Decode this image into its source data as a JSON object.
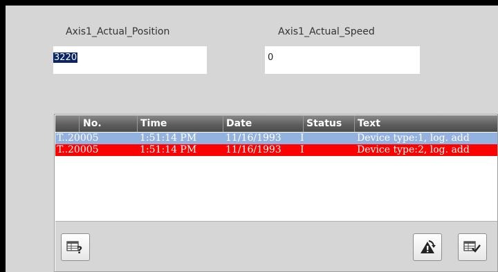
{
  "fields": [
    {
      "label": "Axis1_Actual_Position",
      "value": "3220"
    },
    {
      "label": "Axis1_Actual_Speed",
      "value": "0"
    }
  ],
  "alarm_view": {
    "columns": [
      "No.",
      "Time",
      "Date",
      "Status",
      "Text"
    ],
    "rows": [
      {
        "class": "T...",
        "number": "20005",
        "time": "1:51:14 PM",
        "date": "11/16/1993",
        "status": "I",
        "text": "Device type:1, log. add",
        "color": "#94b2e0"
      },
      {
        "class": "T...",
        "number": "20005",
        "time": "1:51:14 PM",
        "date": "11/16/1993",
        "status": "I",
        "text": "Device type:2, log. add",
        "color": "#ff0000"
      }
    ],
    "buttons": [
      "help-icon",
      "info-icon",
      "acknowledge-icon"
    ]
  }
}
